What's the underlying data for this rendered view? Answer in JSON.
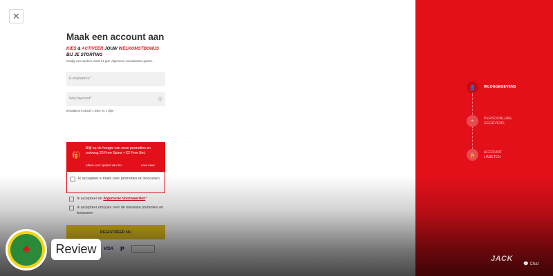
{
  "form": {
    "title": "Maak een account aan",
    "promo_w1": "KIES",
    "promo_w2": "&",
    "promo_w3": "ACTIVEER",
    "promo_w4": "JOUW",
    "promo_w5": "WELKOMSTBONUS",
    "promo_line2": "BIJ JE STORTING",
    "legal": "Geldig voor spelers vanaf 24 jaar. Algemene voorwaarden gelden.",
    "email_placeholder": "E-mailadres*",
    "password_placeholder": "Wachtwoord*",
    "password_hint": "8 karakters inclusief 1 letter en 1 cijfer"
  },
  "promo_box": {
    "text": "Blijf op de hoogte van onze promoties en ontvang 20 Free Spins + €2 Free Bet.",
    "age": "Alleen voor spelers van 24+",
    "more": "Lees meer",
    "checkbox_label": "Ik accepteer e-mails over promoties en bonussen"
  },
  "checks": {
    "terms_prefix": "Ik accepteer de",
    "terms_link": "Algemene Voorwaarden",
    "terms_suffix": "*",
    "notify": "Ik accepteer om(s)es over de nieuwste promoties en bonussen"
  },
  "register_label": "REGISTREER NU",
  "payments": {
    "visa": "VISA",
    "paypal": "P"
  },
  "steps": [
    {
      "label_1": "INLOGGEGEVENS",
      "label_2": ""
    },
    {
      "label_1": "PERSOONLIJKE",
      "label_2": "GEGEVENS"
    },
    {
      "label_1": "ACCOUNT",
      "label_2": "LIMIETEN"
    }
  ],
  "brand": "JACK",
  "chat": "Chat",
  "overlay": {
    "review": "Review"
  },
  "colors": {
    "brand_red": "#e3101a",
    "register_yellow": "#e8c520"
  }
}
